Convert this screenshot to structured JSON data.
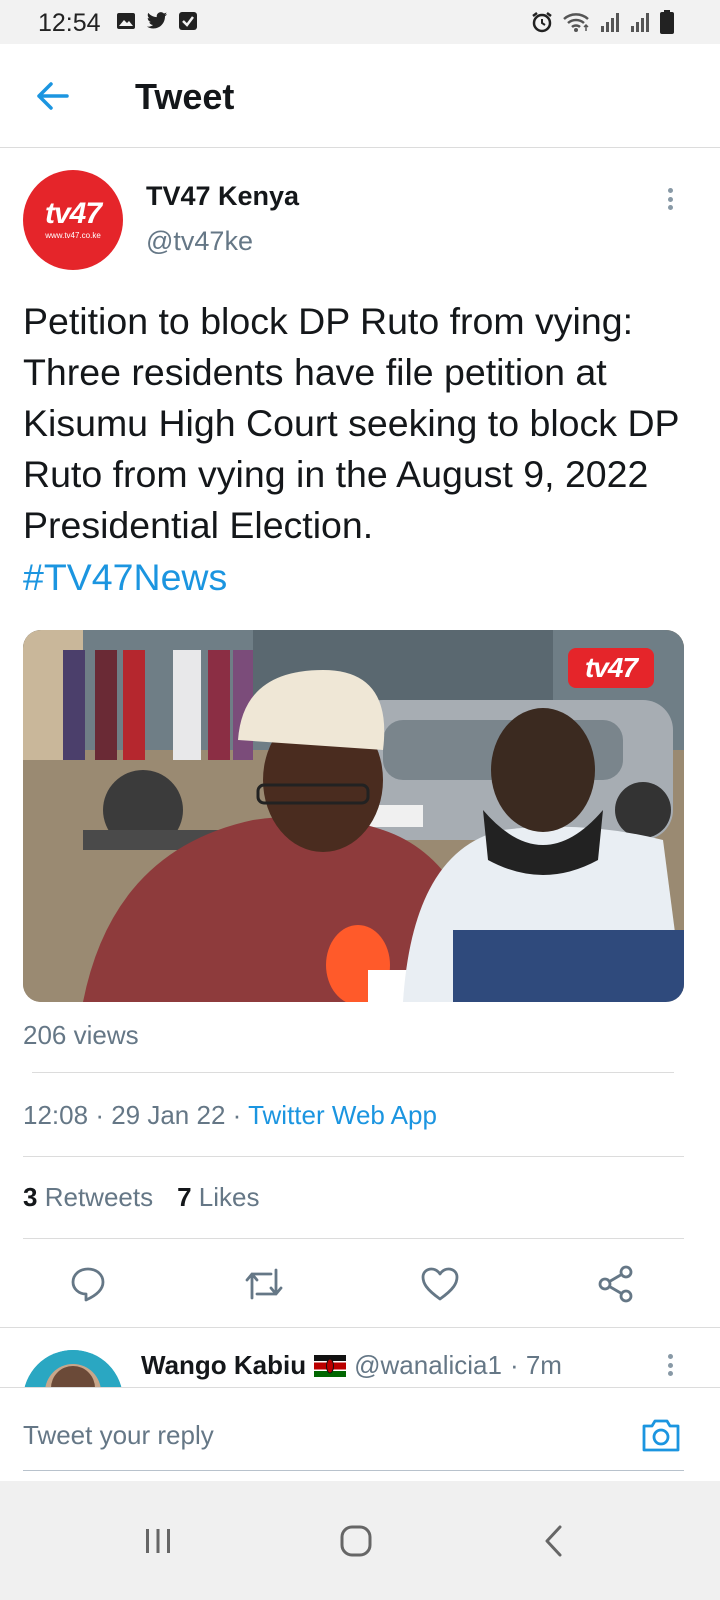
{
  "status_bar": {
    "time": "12:54",
    "left_icons": [
      "image-icon",
      "twitter-icon",
      "check-box-icon"
    ],
    "right_icons": [
      "alarm-icon",
      "wifi-icon",
      "signal-icon",
      "signal-icon",
      "battery-icon"
    ]
  },
  "header": {
    "title": "Tweet",
    "back_icon": "arrow-left-icon"
  },
  "tweet": {
    "author_name": "TV47 Kenya",
    "author_handle": "@tv47ke",
    "avatar_logo": "tv47",
    "avatar_site": "www.tv47.co.ke",
    "text": "Petition to block DP Ruto from vying: Three residents have file petition at Kisumu High Court seeking to block DP Ruto from vying in the August 9, 2022 Presidential Election.",
    "hashtag": "#TV47News",
    "media_watermark": "tv47",
    "views": "206 views",
    "time": "12:08",
    "date": "29 Jan 22",
    "source": "Twitter Web App",
    "retweets_count": "3",
    "retweets_label": "Retweets",
    "likes_count": "7",
    "likes_label": "Likes"
  },
  "actions": [
    "reply-icon",
    "retweet-icon",
    "like-icon",
    "share-icon"
  ],
  "reply_preview": {
    "name": "Wango Kabiu",
    "handle": "@wanalicia1",
    "time": "· 7m"
  },
  "composer": {
    "placeholder": "Tweet your reply"
  },
  "colors": {
    "accent": "#1b95e0",
    "secondary_text": "#657786",
    "brand_red": "#e5252a"
  }
}
